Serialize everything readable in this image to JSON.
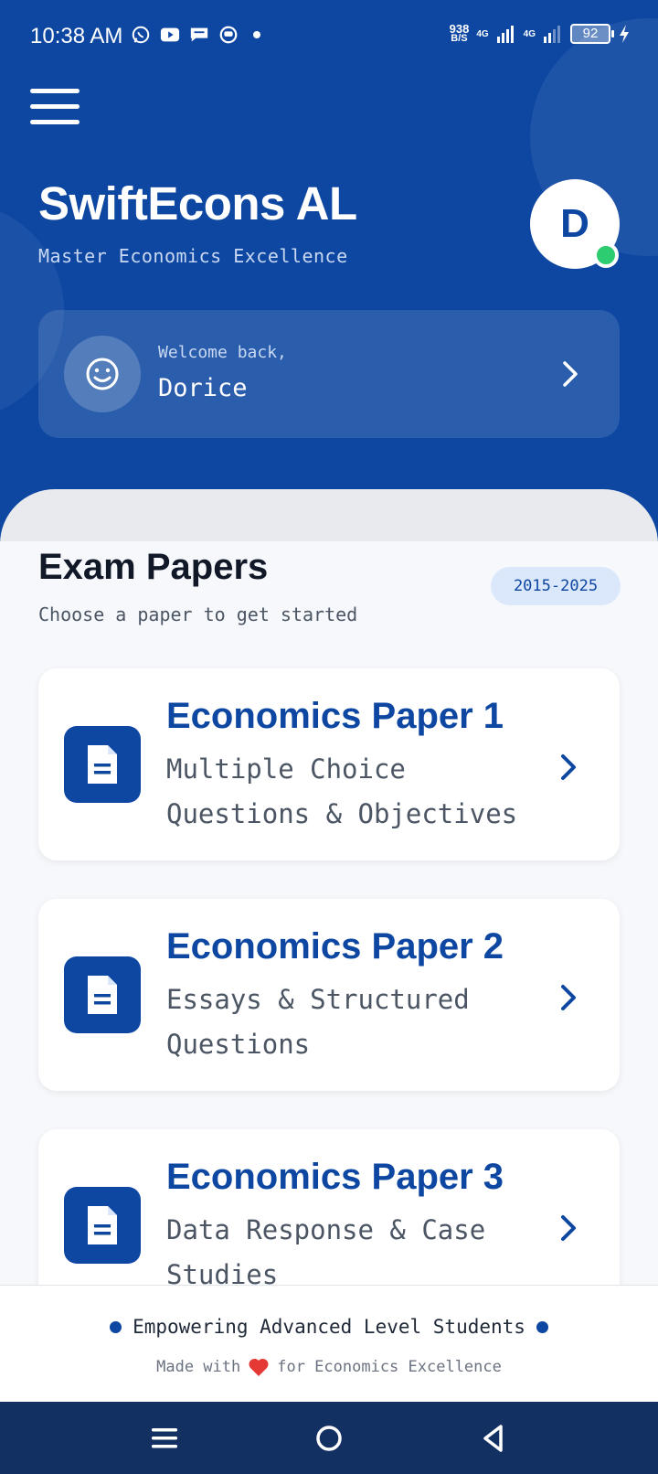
{
  "status_bar": {
    "time": "10:38 AM",
    "net_speed_value": "938",
    "net_speed_unit": "B/S",
    "network_1": "4G",
    "network_2": "4G",
    "battery": "92"
  },
  "header": {
    "app_title": "SwiftEcons AL",
    "subtitle": "Master Economics Excellence",
    "avatar_letter": "D",
    "welcome_label": "Welcome back,",
    "user_name": "Dorice"
  },
  "exam_section": {
    "title": "Exam Papers",
    "subtitle": "Choose a paper to get started",
    "year_range": "2015-2025",
    "papers": [
      {
        "title": "Economics Paper 1",
        "description": "Multiple Choice Questions & Objectives"
      },
      {
        "title": "Economics Paper 2",
        "description": "Essays & Structured Questions"
      },
      {
        "title": "Economics Paper 3",
        "description": "Data Response & Case Studies"
      }
    ]
  },
  "footer": {
    "tagline": "Empowering Advanced Level Students",
    "made_with_prefix": "Made with",
    "made_with_suffix": "for Economics Excellence"
  },
  "colors": {
    "primary": "#0d47a1",
    "online": "#2ecc71",
    "heart": "#e53935",
    "nav_bar": "#123062"
  },
  "icons": {
    "menu": "hamburger-menu-icon",
    "welcome": "smiley-face-icon",
    "paper": "document-icon",
    "chevron": "chevron-right-icon",
    "heart": "heart-icon"
  }
}
